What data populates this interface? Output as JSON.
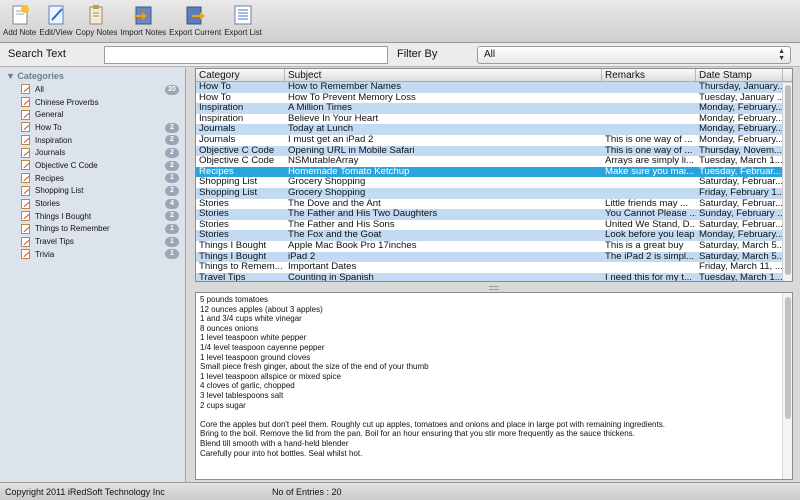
{
  "toolbar": {
    "buttons": [
      {
        "label": "Add Note",
        "icon": "add-note-icon"
      },
      {
        "label": "Edit/View",
        "icon": "edit-view-icon"
      },
      {
        "label": "Copy Notes",
        "icon": "copy-notes-icon"
      },
      {
        "label": "Import Notes",
        "icon": "import-notes-icon"
      },
      {
        "label": "Export Current",
        "icon": "export-current-icon"
      },
      {
        "label": "Export List",
        "icon": "export-list-icon"
      }
    ]
  },
  "search": {
    "label": "Search Text",
    "value": "",
    "filter_label": "Filter By",
    "filter_value": "All"
  },
  "sidebar": {
    "header": "Categories",
    "items": [
      {
        "label": "All",
        "count": "20"
      },
      {
        "label": "Chinese Proverbs",
        "count": ""
      },
      {
        "label": "General",
        "count": ""
      },
      {
        "label": "How To",
        "count": "2"
      },
      {
        "label": "Inspiration",
        "count": "2"
      },
      {
        "label": "Journals",
        "count": "2"
      },
      {
        "label": "Objective C Code",
        "count": "2"
      },
      {
        "label": "Recipes",
        "count": "1"
      },
      {
        "label": "Shopping List",
        "count": "2"
      },
      {
        "label": "Stories",
        "count": "4"
      },
      {
        "label": "Things I Bought",
        "count": "2"
      },
      {
        "label": "Things to Remember",
        "count": "1"
      },
      {
        "label": "Travel Tips",
        "count": "1"
      },
      {
        "label": "Trivia",
        "count": "1"
      }
    ]
  },
  "table": {
    "columns": [
      "Category",
      "Subject",
      "Remarks",
      "Date Stamp"
    ],
    "selected_index": 8,
    "rows": [
      [
        "How To",
        "How to Remember Names",
        "",
        "Thursday, January..."
      ],
      [
        "How To",
        "How To Prevent Memory Loss",
        "",
        "Tuesday, January ..."
      ],
      [
        "Inspiration",
        "A Million Times",
        "",
        "Monday, February..."
      ],
      [
        "Inspiration",
        "Believe In Your Heart",
        "",
        "Monday, February..."
      ],
      [
        "Journals",
        "Today at Lunch",
        "",
        "Monday, February..."
      ],
      [
        "Journals",
        "I must get an iPad 2",
        "This is one way of ...",
        "Monday, February..."
      ],
      [
        "Objective C Code",
        "Opening URL in Mobile Safari",
        "This is one way of ...",
        "Thursday, Novem..."
      ],
      [
        "Objective C Code",
        "NSMutableArray",
        "Arrays are simply li...",
        "Tuesday, March 1..."
      ],
      [
        "Recipes",
        "Homemade Tomato Ketchup",
        "Make sure you mai...",
        "Tuesday, Februar..."
      ],
      [
        "Shopping List",
        "Grocery Shopping",
        "",
        "Saturday, Februar..."
      ],
      [
        "Shopping List",
        "Grocery Shopping",
        "",
        "Friday, February 1..."
      ],
      [
        "Stories",
        "The Dove and the Ant",
        "Little friends may ...",
        "Saturday, Februar..."
      ],
      [
        "Stories",
        "The Father and His Two Daughters",
        "You Cannot Please ...",
        "Sunday, February ..."
      ],
      [
        "Stories",
        "The Father and His Sons",
        "United We Stand, D...",
        "Saturday, Februar..."
      ],
      [
        "Stories",
        "The Fox and the Goat",
        "Look before you leap",
        "Monday, February..."
      ],
      [
        "Things I Bought",
        "Apple Mac Book Pro 17inches",
        "This is a great buy",
        "Saturday, March 5..."
      ],
      [
        "Things I Bought",
        "iPad 2",
        "The iPad 2 is simpl...",
        "Saturday, March 5..."
      ],
      [
        "Things to Remem...",
        "Important Dates",
        "",
        "Friday, March 11, ..."
      ],
      [
        "Travel Tips",
        "Counting in Spanish",
        "I need this for my t...",
        "Tuesday, March 1..."
      ]
    ]
  },
  "note": {
    "lines": [
      "5 pounds tomatoes",
      "12 ounces apples (about 3 apples)",
      "1 and 3/4 cups white vinegar",
      "8 ounces onions",
      "1 level teaspoon white pepper",
      "1/4 level teaspoon cayenne pepper",
      "1 level teaspoon ground cloves",
      "Small piece fresh ginger, about the size of the end of your thumb",
      "1 level teaspoon allspice or mixed spice",
      "4 cloves of garlic, chopped",
      "3 level tablespoons salt",
      "2 cups sugar",
      "",
      "Core the apples but don't peel them.  Roughly cut up apples, tomatoes and onions and place in large pot with remaining ingredients.",
      "Bring to the boil.  Remove the lid from the pan.  Boil for an hour ensuring that you stir more frequently as the sauce thickens.",
      "Blend till smooth with a hand-held blender",
      "Carefully pour into hot bottles.  Seal whilst hot."
    ]
  },
  "status": {
    "copyright": "Copyright 2011 iRedSoft Technology Inc",
    "entries": "No of Entries : 20"
  }
}
